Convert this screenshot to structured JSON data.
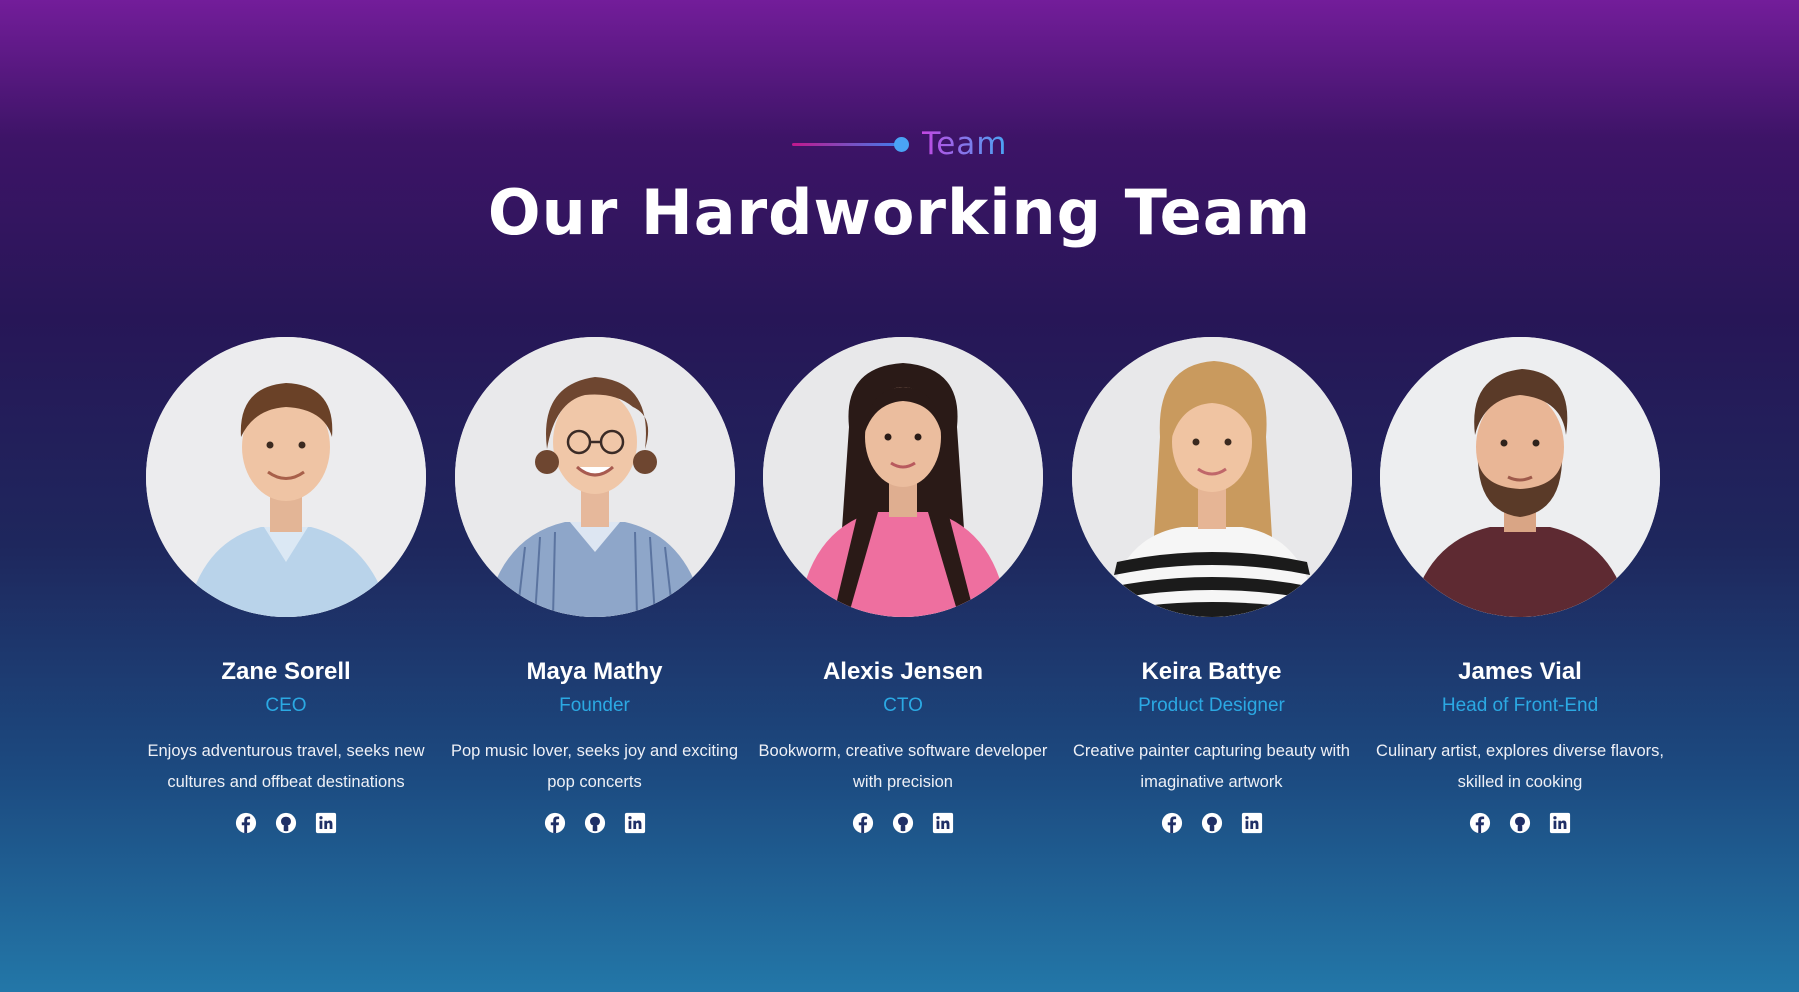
{
  "header": {
    "eyebrow": "Team",
    "title": "Our Hardworking Team"
  },
  "colors": {
    "accent": "#2ba9e3",
    "eyebrow_start": "#c247e2",
    "eyebrow_end": "#48a6f3"
  },
  "members": [
    {
      "name": "Zane Sorell",
      "role": "CEO",
      "bio": "Enjoys adventurous travel, seeks new cultures and offbeat destinations",
      "photo": "man-light-blue-shirt"
    },
    {
      "name": "Maya Mathy",
      "role": "Founder",
      "bio": "Pop music lover, seeks joy and exciting pop concerts",
      "photo": "woman-glasses-striped-shirt"
    },
    {
      "name": "Alexis Jensen",
      "role": "CTO",
      "bio": "Bookworm, creative software developer with precision",
      "photo": "woman-pink-sweater"
    },
    {
      "name": "Keira Battye",
      "role": "Product Designer",
      "bio": "Creative painter capturing beauty with imaginative artwork",
      "photo": "woman-striped-top"
    },
    {
      "name": "James Vial",
      "role": "Head of Front-End",
      "bio": "Culinary artist, explores diverse flavors, skilled in cooking",
      "photo": "man-beard-maroon-shirt"
    }
  ],
  "social_icons": [
    "facebook-icon",
    "github-icon",
    "linkedin-icon"
  ]
}
